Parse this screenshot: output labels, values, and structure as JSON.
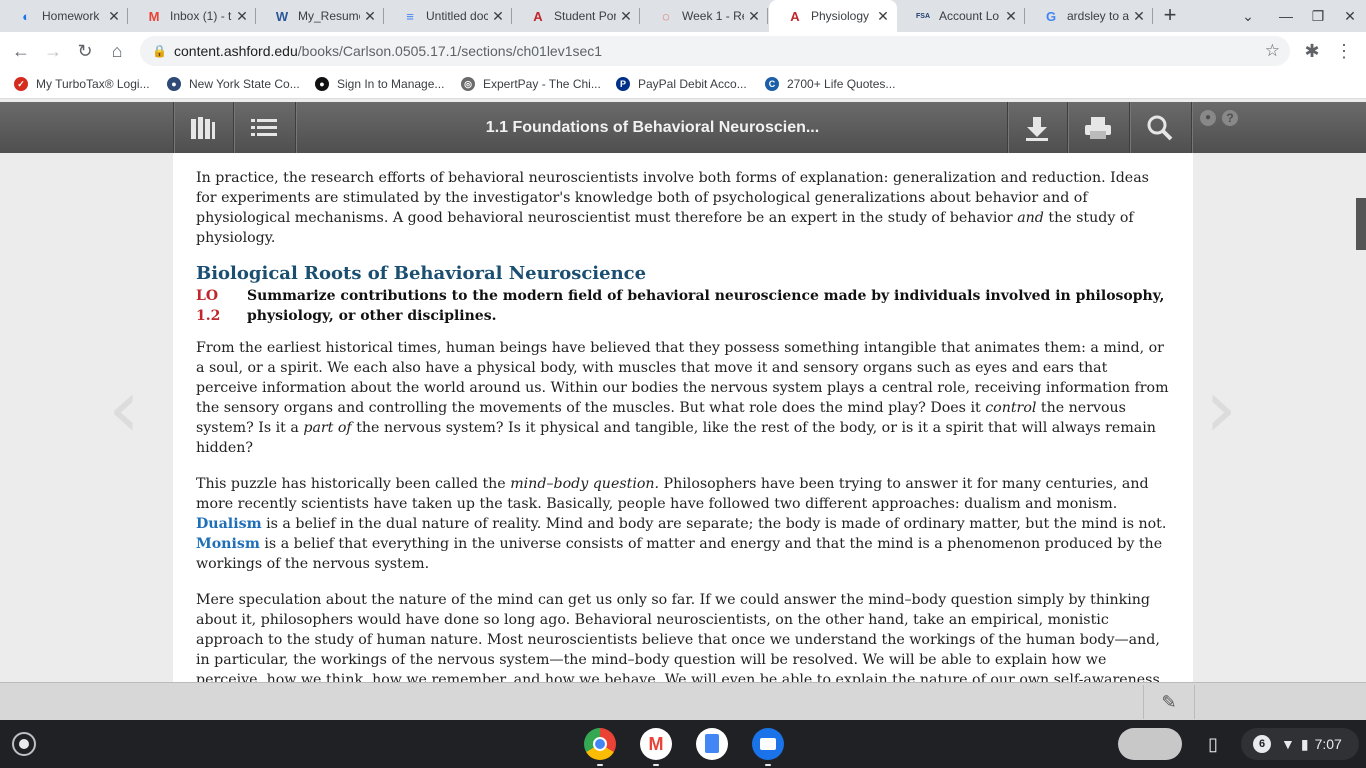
{
  "tabs": [
    {
      "title": "Homework",
      "fav": "ashford-icon",
      "color": "#1a73e8",
      "glyph": "◐"
    },
    {
      "title": "Inbox (1) - t",
      "fav": "gmail-icon",
      "color": "#ea4335",
      "glyph": "M"
    },
    {
      "title": "My_Resume",
      "fav": "word-icon",
      "color": "#2b579a",
      "glyph": "W"
    },
    {
      "title": "Untitled doc",
      "fav": "docs-icon",
      "color": "#4285f4",
      "glyph": "≡"
    },
    {
      "title": "Student Por",
      "fav": "university-icon",
      "color": "#c0272d",
      "glyph": "A"
    },
    {
      "title": "Week 1 - Re",
      "fav": "loading-icon",
      "color": "#d93025",
      "glyph": "◌"
    },
    {
      "title": "Physiology",
      "fav": "university-icon",
      "color": "#c0272d",
      "glyph": "A"
    },
    {
      "title": "Account Lo",
      "fav": "fsa-icon",
      "color": "#1c3f6e",
      "glyph": "FSA"
    },
    {
      "title": "ardsley to a",
      "fav": "google-icon",
      "color": "#4285f4",
      "glyph": "G"
    }
  ],
  "active_tab": 6,
  "url": {
    "host": "content.ashford.edu",
    "path": "/books/Carlson.0505.17.1/sections/ch01lev1sec1"
  },
  "bookmarks": [
    {
      "label": "My TurboTax® Logi...",
      "color": "#d52b1e",
      "glyph": "✓"
    },
    {
      "label": "New York State Co...",
      "color": "#2f4a77",
      "glyph": "●"
    },
    {
      "label": "Sign In to Manage...",
      "color": "#111111",
      "glyph": "●"
    },
    {
      "label": "ExpertPay - The Chi...",
      "color": "#6b6b6b",
      "glyph": "◎"
    },
    {
      "label": "PayPal Debit Acco...",
      "color": "#003087",
      "glyph": "P"
    },
    {
      "label": "2700+ Life Quotes...",
      "color": "#1a5fa8",
      "glyph": "C"
    }
  ],
  "reader": {
    "title": "1.1 Foundations of Behavioral Neuroscien..."
  },
  "content": {
    "intro_a": "In practice, the research efforts of behavioral neuroscientists involve both forms of explanation: generalization and reduction. Ideas for experiments are stimulated by the investigator's knowledge both of psychological generalizations about behavior and of physiological mechanisms. A good behavioral neuroscientist must therefore be an expert in the study of behavior ",
    "intro_and": "and",
    "intro_b": " the study of physiology.",
    "heading": "Biological Roots of Behavioral Neuroscience",
    "lo_tag": "LO 1.2",
    "lo_text": "Summarize contributions to the modern field of behavioral neuroscience made by individuals involved in philosophy, physiology, or other disciplines.",
    "p1_a": "From the earliest historical times, human beings have believed that they possess something intangible that animates them: a mind, or a soul, or a spirit. We each also have a physical body, with muscles that move it and sensory organs such as eyes and ears that perceive information about the world around us. Within our bodies the nervous system plays a central role, receiving information from the sensory organs and controlling the movements of the muscles. But what role does the mind play? Does it ",
    "p1_control": "control",
    "p1_b": " the nervous system? Is it a ",
    "p1_partof": "part of",
    "p1_c": " the nervous system? Is it physical and tangible, like the rest of the body, or is it a spirit that will always remain hidden?",
    "p2_a": "This puzzle has historically been called the ",
    "p2_mbq": "mind–body question.",
    "p2_b": " Philosophers have been trying to answer it for many centuries, and more recently scientists have taken up the task. Basically, people have followed two different approaches: dualism and monism. ",
    "p2_dualism": "Dualism",
    "p2_c": " is a belief in the dual nature of reality. Mind and body are separate; the body is made of ordinary matter, but the mind is not. ",
    "p2_monism": "Monism",
    "p2_d": " is a belief that everything in the universe consists of matter and energy and that the mind is a phenomenon produced by the workings of the nervous system.",
    "p3": "Mere speculation about the nature of the mind can get us only so far. If we could answer the mind–body question simply by thinking about it, philosophers would have done so long ago. Behavioral neuroscientists, on the other hand, take an empirical, monistic approach to the study of human nature. Most neuroscientists believe that once we understand the workings of the human body—and, in particular, the workings of the nervous system—the mind–body question will be resolved. We will be able to explain how we perceive, how we think, how we remember, and how we behave. We will even be able to explain the nature of our own self-awareness. This section explores some of the important discoveries of the past that contributed to today's field of behavioral neuroscience."
  },
  "shelf": {
    "notification_count": "6",
    "time": "7:07"
  }
}
